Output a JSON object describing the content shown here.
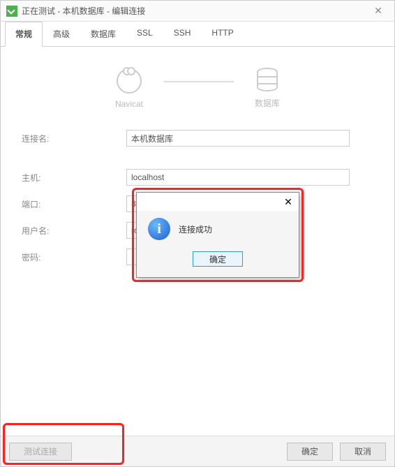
{
  "window": {
    "title": "正在测试 - 本机数据库 - 编辑连接"
  },
  "tabs": [
    "常规",
    "高级",
    "数据库",
    "SSL",
    "SSH",
    "HTTP"
  ],
  "active_tab": 0,
  "diagram": {
    "left_label": "Navicat",
    "right_label": "数据库"
  },
  "form": {
    "conn_name_label": "连接名:",
    "conn_name_value": "本机数据库",
    "host_label": "主机:",
    "host_value": "localhost",
    "port_label": "端口:",
    "port_value": "3306",
    "user_label": "用户名:",
    "user_value": "root",
    "pass_label": "密码:",
    "pass_value": ""
  },
  "buttons": {
    "test": "测试连接",
    "ok": "确定",
    "cancel": "取消"
  },
  "dialog": {
    "message": "连接成功",
    "ok": "确定"
  }
}
